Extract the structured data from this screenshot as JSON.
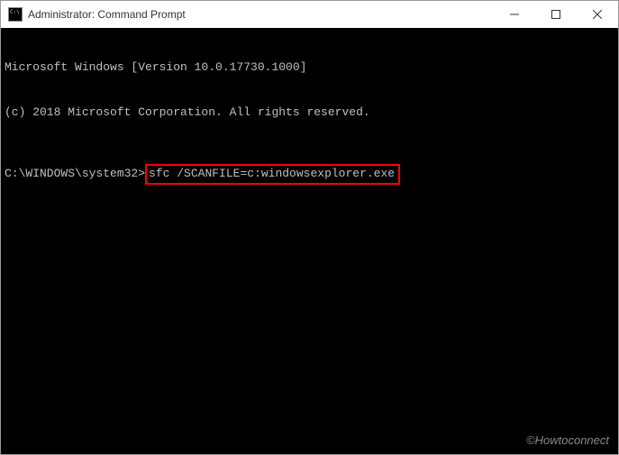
{
  "titlebar": {
    "title": "Administrator: Command Prompt"
  },
  "terminal": {
    "line1": "Microsoft Windows [Version 10.0.17730.1000]",
    "line2": "(c) 2018 Microsoft Corporation. All rights reserved.",
    "prompt": "C:\\WINDOWS\\system32>",
    "command": "sfc /SCANFILE=c:windowsexplorer.exe"
  },
  "watermark": "©Howtoconnect"
}
